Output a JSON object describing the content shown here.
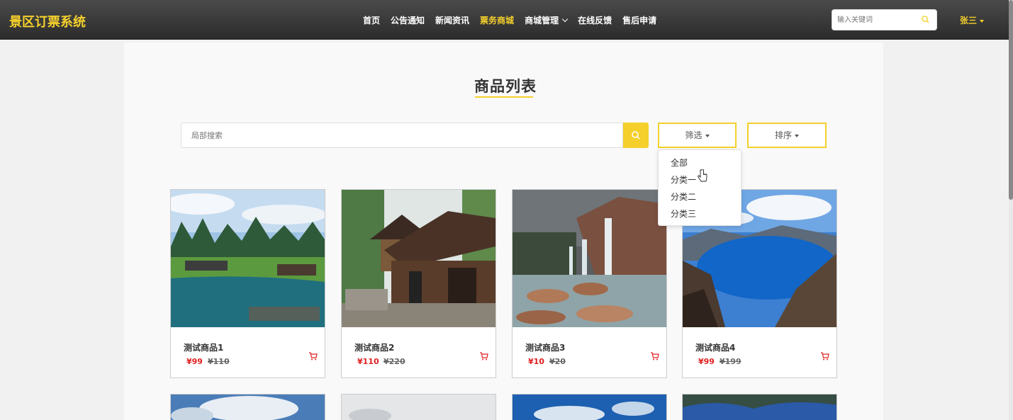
{
  "app": {
    "brand": "景区订票系统"
  },
  "nav": {
    "items": [
      "首页",
      "公告通知",
      "新闻资讯",
      "票务商城",
      "商城管理",
      "在线反馈",
      "售后申请"
    ],
    "active_index": 3
  },
  "header": {
    "search_placeholder": "输入关键词",
    "user": "张三"
  },
  "main": {
    "title": "商品列表",
    "search_placeholder": "局部搜索",
    "filter_label": "筛选",
    "sort_label": "排序",
    "filter_options": [
      "全部",
      "分类一",
      "分类二",
      "分类三"
    ]
  },
  "products": [
    {
      "name": "测试商品1",
      "price": "¥99",
      "old_price": "¥110"
    },
    {
      "name": "测试商品2",
      "price": "¥110",
      "old_price": "¥220"
    },
    {
      "name": "测试商品3",
      "price": "¥10",
      "old_price": "¥20"
    },
    {
      "name": "测试商品4",
      "price": "¥99",
      "old_price": "¥199"
    }
  ],
  "colors": {
    "accent": "#f5d02c",
    "price": "#e02020",
    "nav_bg": "#3a3a3a"
  }
}
